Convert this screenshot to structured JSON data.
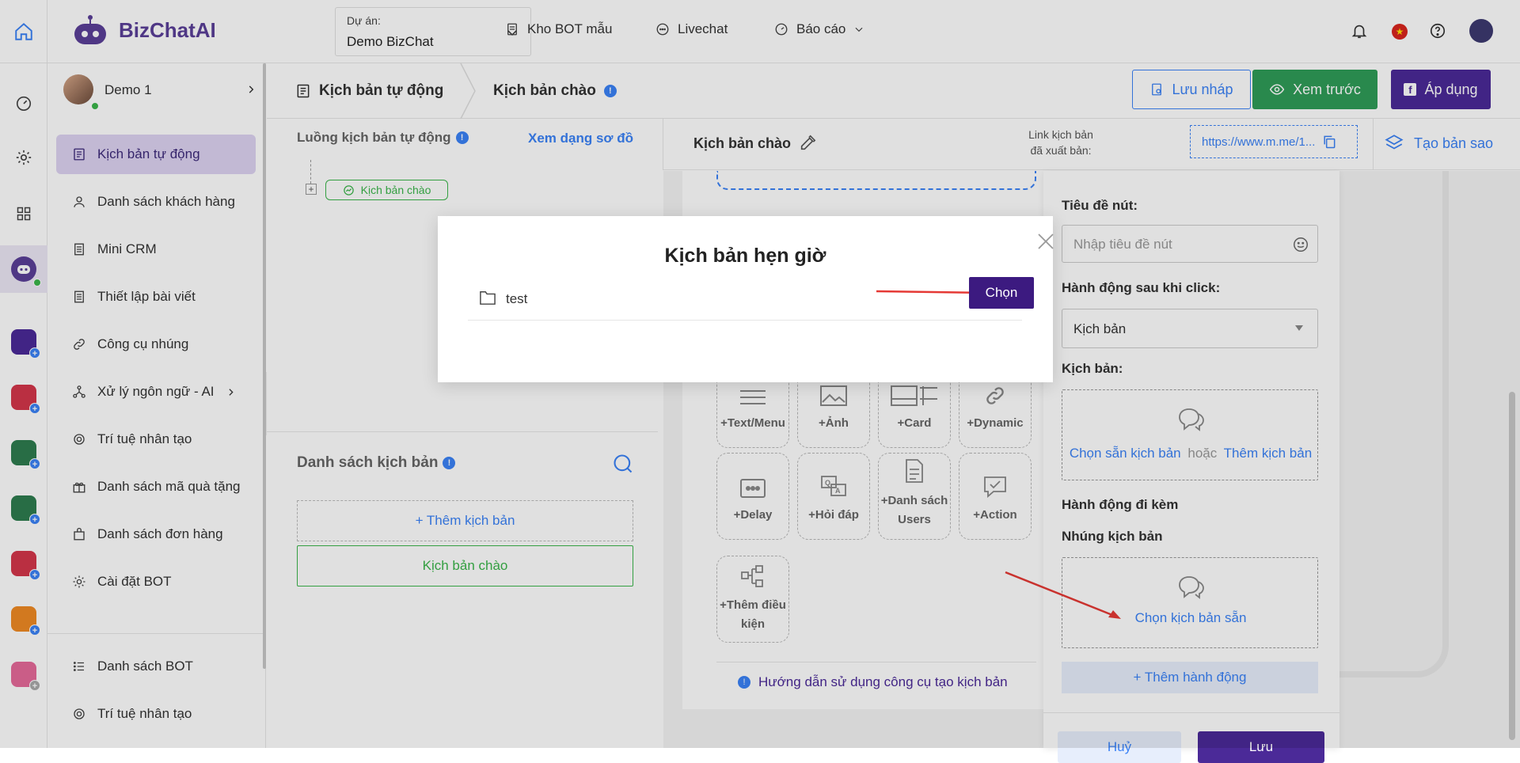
{
  "app": {
    "logo_text": "BizChatAI"
  },
  "header": {
    "project_label": "Dự án:",
    "project_value": "Demo BizChat",
    "nav": [
      "Kho BOT mẫu",
      "Livechat",
      "Báo cáo"
    ]
  },
  "user": {
    "name": "Demo 1"
  },
  "sidebar": {
    "items": [
      {
        "label": "Kịch bản tự động"
      },
      {
        "label": "Danh sách khách hàng"
      },
      {
        "label": "Mini CRM"
      },
      {
        "label": "Thiết lập bài viết"
      },
      {
        "label": "Công cụ nhúng"
      },
      {
        "label": "Xử lý ngôn ngữ - AI"
      },
      {
        "label": "Trí tuệ nhân tạo"
      },
      {
        "label": "Danh sách mã quà tặng"
      },
      {
        "label": "Danh sách đơn hàng"
      },
      {
        "label": "Cài đặt BOT"
      }
    ],
    "bottom_items": [
      {
        "label": "Danh sách BOT"
      },
      {
        "label": "Trí tuệ nhân tạo"
      }
    ]
  },
  "toolbar": {
    "breadcrumb_1": "Kịch bản tự động",
    "breadcrumb_2": "Kịch bản chào",
    "save_draft": "Lưu nháp",
    "preview": "Xem trước",
    "apply": "Áp dụng"
  },
  "flow": {
    "title": "Luồng kịch bản tự động",
    "view_link": "Xem dạng sơ đồ",
    "node_label": "Kịch bản chào"
  },
  "script_list": {
    "title": "Danh sách kịch bản",
    "add": "+ Thêm kịch bản",
    "item": "Kịch bản chào"
  },
  "editor": {
    "title": "Kịch bản chào",
    "link_label_1": "Link kịch bản",
    "link_label_2": "đã xuất bản:",
    "link_value": "https://www.m.me/1...",
    "duplicate": "Tạo bản sao"
  },
  "tools": [
    {
      "label": "+Text/Menu"
    },
    {
      "label": "+Ảnh"
    },
    {
      "label": "+Card"
    },
    {
      "label": "+Dynamic"
    },
    {
      "label": "+Delay"
    },
    {
      "label": "+Hỏi đáp"
    },
    {
      "label": "+Danh sách Users"
    },
    {
      "label": "+Action"
    },
    {
      "label": "+Thêm điều kiện"
    }
  ],
  "guide": "Hướng dẫn sử dụng công cụ tạo kịch bản",
  "right_panel": {
    "button_title_label": "Tiêu đề nút:",
    "button_title_placeholder": "Nhập tiêu đề nút",
    "action_label": "Hành động sau khi click:",
    "action_value": "Kịch bản",
    "script_label": "Kịch bản:",
    "choose_existing": "Chọn sẵn kịch bản",
    "or": "hoặc",
    "add_script": "Thêm kịch bản",
    "attached_label": "Hành động đi kèm",
    "embed_label": "Nhúng kịch bản",
    "choose_embed": "Chọn kịch bản sẵn",
    "add_action": "+ Thêm hành động",
    "cancel": "Huỷ",
    "save": "Lưu"
  },
  "modal": {
    "title": "Kịch bản hẹn giờ",
    "item": "test",
    "choose": "Chọn"
  },
  "colors": {
    "brand": "#5b3f98",
    "apply": "#4b2a98",
    "preview": "#2f9d58",
    "link": "#3b82f6",
    "success": "#3bb54a"
  }
}
